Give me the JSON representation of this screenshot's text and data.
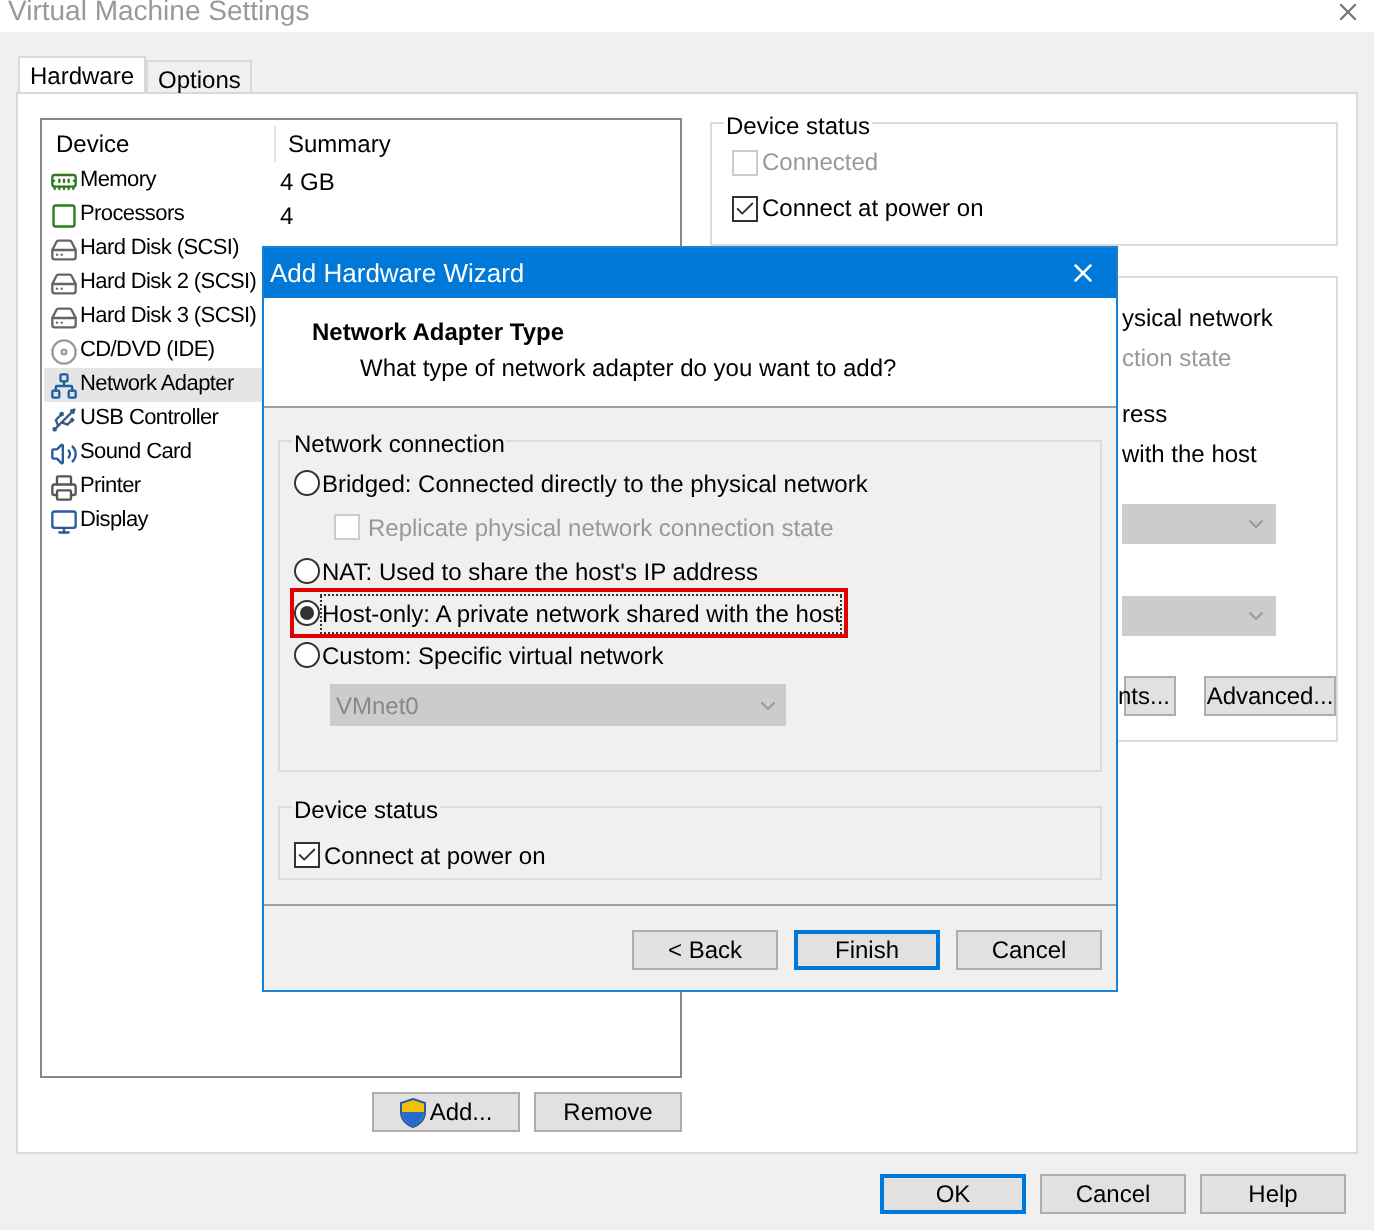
{
  "window": {
    "title": "Virtual Machine Settings"
  },
  "tabs": [
    {
      "label": "Hardware",
      "selected": true
    },
    {
      "label": "Options",
      "selected": false
    }
  ],
  "devices": {
    "columns": [
      "Device",
      "Summary"
    ],
    "rows": [
      {
        "kind": "memory",
        "name": "Memory",
        "summary": "4 GB",
        "selected": false
      },
      {
        "kind": "processor",
        "name": "Processors",
        "summary": "4",
        "selected": false
      },
      {
        "kind": "disk",
        "name": "Hard Disk (SCSI)",
        "selected": false
      },
      {
        "kind": "disk",
        "name": "Hard Disk 2 (SCSI)",
        "selected": false
      },
      {
        "kind": "disk",
        "name": "Hard Disk 3 (SCSI)",
        "selected": false
      },
      {
        "kind": "cd",
        "name": "CD/DVD (IDE)",
        "selected": false
      },
      {
        "kind": "network",
        "name": "Network Adapter",
        "selected": true
      },
      {
        "kind": "usb",
        "name": "USB Controller",
        "selected": false
      },
      {
        "kind": "sound",
        "name": "Sound Card",
        "selected": false
      },
      {
        "kind": "printer",
        "name": "Printer",
        "selected": false
      },
      {
        "kind": "display",
        "name": "Display",
        "selected": false
      }
    ]
  },
  "device_status": {
    "title": "Device status",
    "items": [
      {
        "label": "Connected",
        "checked": false,
        "disabled": true
      },
      {
        "label": "Connect at power on",
        "checked": true,
        "disabled": false
      }
    ]
  },
  "connection_fragments": [
    {
      "text": "ysical network",
      "disabled": false
    },
    {
      "text": "ction state",
      "disabled": true
    },
    {
      "text": "ress",
      "disabled": false
    },
    {
      "text": "with the host",
      "disabled": false
    }
  ],
  "connection_buttons": [
    "nts...",
    "Advanced..."
  ],
  "list_buttons": [
    {
      "label": "Add...",
      "shield": true
    },
    {
      "label": "Remove",
      "shield": false
    }
  ],
  "footer_buttons": [
    {
      "label": "OK",
      "default": true
    },
    {
      "label": "Cancel",
      "default": false
    },
    {
      "label": "Help",
      "default": false
    }
  ],
  "dialog": {
    "title": "Add Hardware Wizard",
    "heading": "Network Adapter Type",
    "subheading": "What type of network adapter do you want to add?",
    "network_group": "Network connection",
    "options": [
      {
        "label": "Bridged: Connected directly to the physical network",
        "selected": false,
        "highlighted": false
      },
      {
        "label": "NAT: Used to share the host's IP address",
        "selected": false,
        "highlighted": false
      },
      {
        "label": "Host-only: A private network shared with the host",
        "selected": true,
        "highlighted": true
      },
      {
        "label": "Custom: Specific virtual network",
        "selected": false,
        "highlighted": false
      }
    ],
    "replicate": {
      "label": "Replicate physical network connection state",
      "checked": false,
      "disabled": true
    },
    "custom_network": {
      "value": "VMnet0",
      "disabled": true
    },
    "status_group": "Device status",
    "connect": {
      "label": "Connect at power on",
      "checked": true
    },
    "buttons": [
      {
        "label": "< Back",
        "default": false
      },
      {
        "label": "Finish",
        "default": true
      },
      {
        "label": "Cancel",
        "default": false
      }
    ]
  }
}
